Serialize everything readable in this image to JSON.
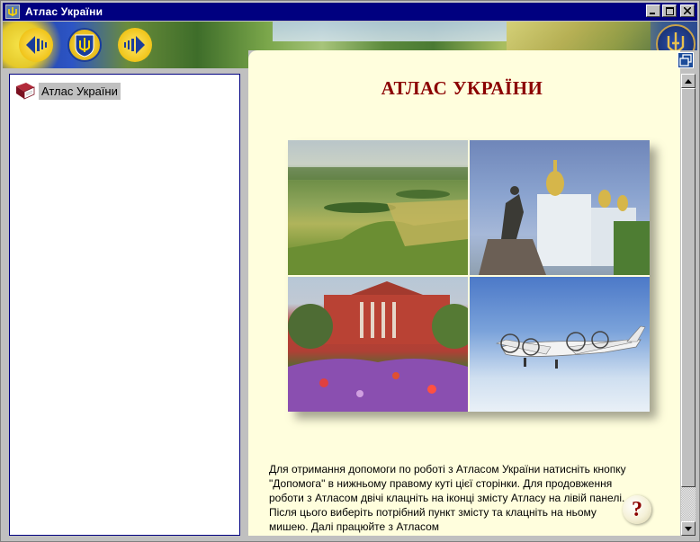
{
  "window": {
    "title": "Атлас України",
    "controls": {
      "minimize": "_",
      "maximize": "□",
      "close": "×"
    }
  },
  "toolbar": {
    "back_icon": "arrow-left-icon",
    "home_icon": "coat-of-arms-icon",
    "forward_icon": "arrow-right-icon",
    "emblem_icon": "trident-icon"
  },
  "sidebar": {
    "items": [
      {
        "label": "Атлас України",
        "icon": "book-icon"
      }
    ]
  },
  "main": {
    "title": "АТЛАС УКРАЇНИ",
    "photos": [
      {
        "name": "landscape-photo"
      },
      {
        "name": "monastery-photo"
      },
      {
        "name": "university-photo"
      },
      {
        "name": "airplane-photo"
      }
    ],
    "help_text": "Для отримання допомоги по роботі з Атласом України натисніть кнопку \"Допомога\" в нижньому правому куті цієї сторінки.  Для продовження роботи з Атласом двічі клацніть на іконці змісту Атласу на лівій панелі. Після цього виберіть потрібний пункт змісту та клацніть на ньому мишею. Далі працюйте з Атласом",
    "help_button_label": "?"
  },
  "colors": {
    "title_bar": "#000080",
    "content_bg": "#fffedd",
    "title_text": "#8b0000"
  }
}
